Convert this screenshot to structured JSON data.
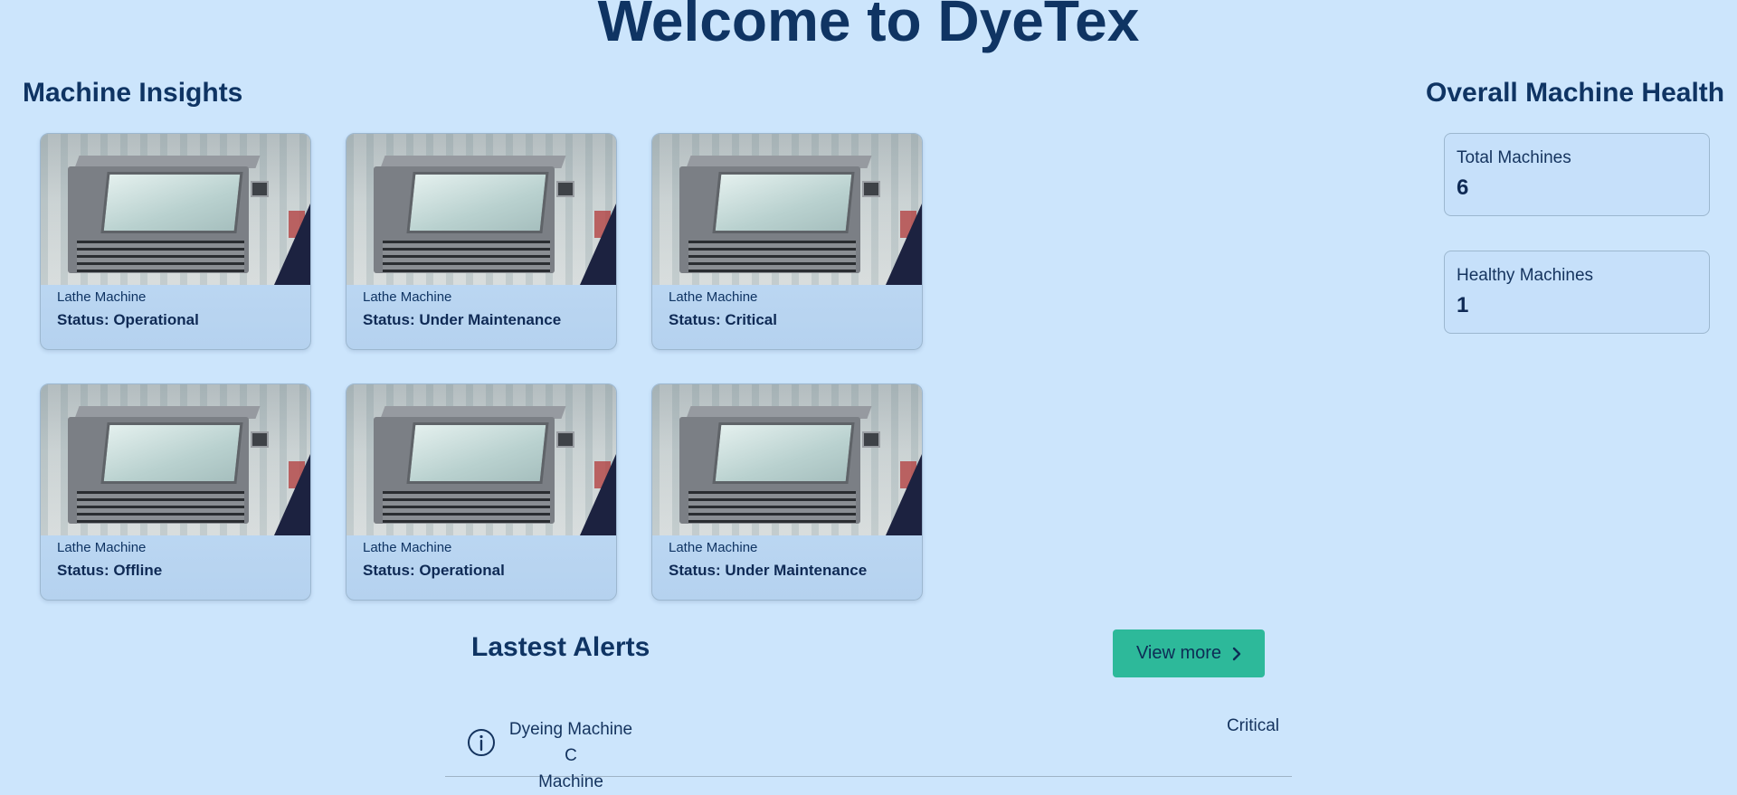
{
  "page": {
    "title": "Welcome to DyeTex"
  },
  "insights": {
    "title": "Machine Insights",
    "machines": [
      {
        "name": "Lathe Machine",
        "status": "Status: Operational"
      },
      {
        "name": "Lathe Machine",
        "status": "Status: Under Maintenance"
      },
      {
        "name": "Lathe Machine",
        "status": "Status: Critical"
      },
      {
        "name": "Lathe Machine",
        "status": "Status: Offline"
      },
      {
        "name": "Lathe Machine",
        "status": "Status: Operational"
      },
      {
        "name": "Lathe Machine",
        "status": "Status: Under Maintenance"
      }
    ]
  },
  "health": {
    "title": "Overall Machine Health",
    "stats": [
      {
        "label": "Total Machines",
        "value": "6"
      },
      {
        "label": "Healthy Machines",
        "value": "1"
      }
    ]
  },
  "alerts": {
    "title": "Lastest Alerts",
    "view_more_label": "View more",
    "items": [
      {
        "machine_line1": "Dyeing Machine C",
        "machine_line2": "Machine",
        "severity": "Critical"
      }
    ]
  },
  "icons": {
    "info": "info-icon",
    "chevron": "chevron-right-icon"
  },
  "colors": {
    "background": "#cce5fc",
    "heading": "#0f3463",
    "accent": "#2db99a"
  }
}
